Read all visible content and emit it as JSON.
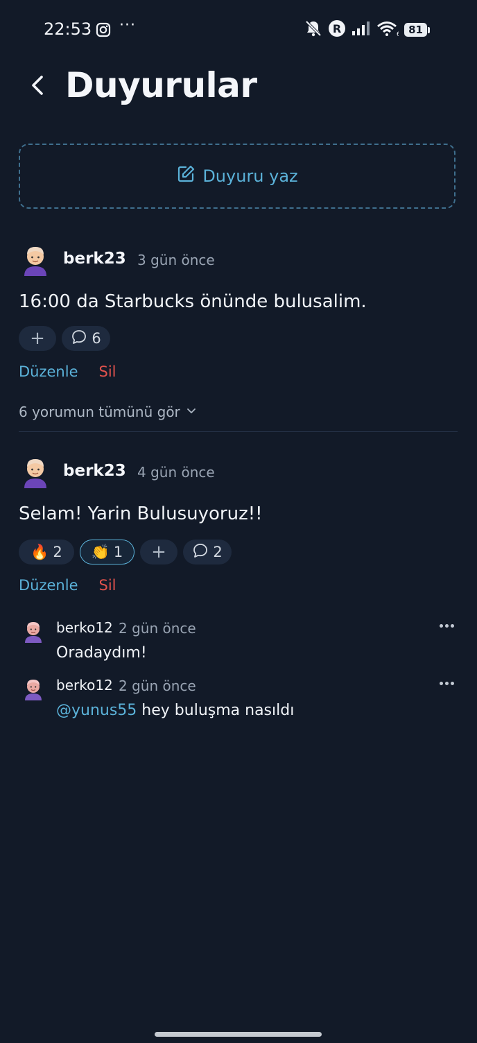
{
  "status_bar": {
    "time": "22:53",
    "overflow": "···",
    "battery": "81"
  },
  "header": {
    "title": "Duyurular"
  },
  "compose": {
    "label": "Duyuru yaz"
  },
  "posts": [
    {
      "user": "berk23",
      "time": "3 gün önce",
      "text": "16:00 da Starbucks önünde bulusalim.",
      "reactions": [],
      "comment_count": "6",
      "edit_label": "Düzenle",
      "delete_label": "Sil",
      "view_all": "6 yorumun tümünü gör"
    },
    {
      "user": "berk23",
      "time": "4 gün önce",
      "text": "Selam! Yarin Bulusuyoruz!!",
      "reactions": [
        {
          "emoji": "🔥",
          "count": "2"
        },
        {
          "emoji": "👏",
          "count": "1"
        }
      ],
      "comment_count": "2",
      "edit_label": "Düzenle",
      "delete_label": "Sil",
      "comments": [
        {
          "user": "berko12",
          "time": "2 gün önce",
          "text": "Oradaydım!"
        },
        {
          "user": "berko12",
          "time": "2 gün önce",
          "mention": "@yunus55",
          "text": " hey buluşma nasıldı"
        }
      ]
    }
  ],
  "colors": {
    "background": "#121a28",
    "accent": "#5bb2d9",
    "danger": "#e0524d"
  }
}
